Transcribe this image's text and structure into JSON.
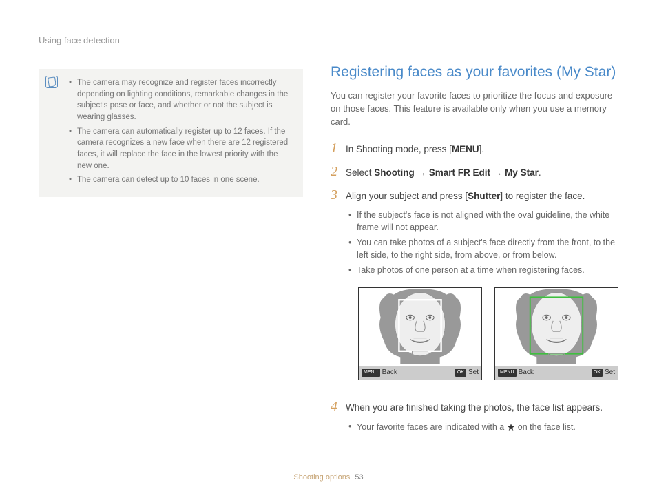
{
  "header": {
    "section": "Using face detection"
  },
  "noteBox": {
    "items": [
      "The camera may recognize and register faces incorrectly depending on lighting conditions, remarkable changes in the subject's pose or face, and whether or not the subject is wearing glasses.",
      "The camera can automatically register up to 12 faces. If the camera recognizes a new face when there are 12 registered faces, it will replace the face in the lowest priority with the new one.",
      "The camera can detect up to 10 faces in one scene."
    ]
  },
  "section": {
    "title": "Registering faces as your favorites (My Star)",
    "intro": "You can register your favorite faces to prioritize the focus and exposure on those faces. This feature is available only when you use a memory card."
  },
  "steps": {
    "s1": {
      "pre": "In Shooting mode, press [",
      "key": "MENU",
      "post": "]."
    },
    "s2": {
      "pre": "Select ",
      "p1": "Shooting",
      "arrow": " → ",
      "p2": "Smart FR Edit",
      "p3": "My Star",
      "post": "."
    },
    "s3": {
      "pre": "Align your subject and press [",
      "key": "Shutter",
      "post": "] to register the face.",
      "subs": [
        "If the subject's face is not aligned with the oval guideline, the white frame will not appear.",
        "You can take photos of a subject's face directly from the front, to the left side, to the right side, from above, or from below.",
        "Take photos of one person at a time when registering faces."
      ]
    },
    "s4": {
      "text": "When you are finished taking the photos, the face list appears.",
      "sub_pre": "Your favorite faces are indicated with a ",
      "sub_post": " on the face list."
    }
  },
  "screens": {
    "bar": {
      "backIcon": "MENU",
      "back": "Back",
      "okIcon": "OK",
      "set": "Set"
    }
  },
  "footer": {
    "section": "Shooting options",
    "page": "53"
  }
}
